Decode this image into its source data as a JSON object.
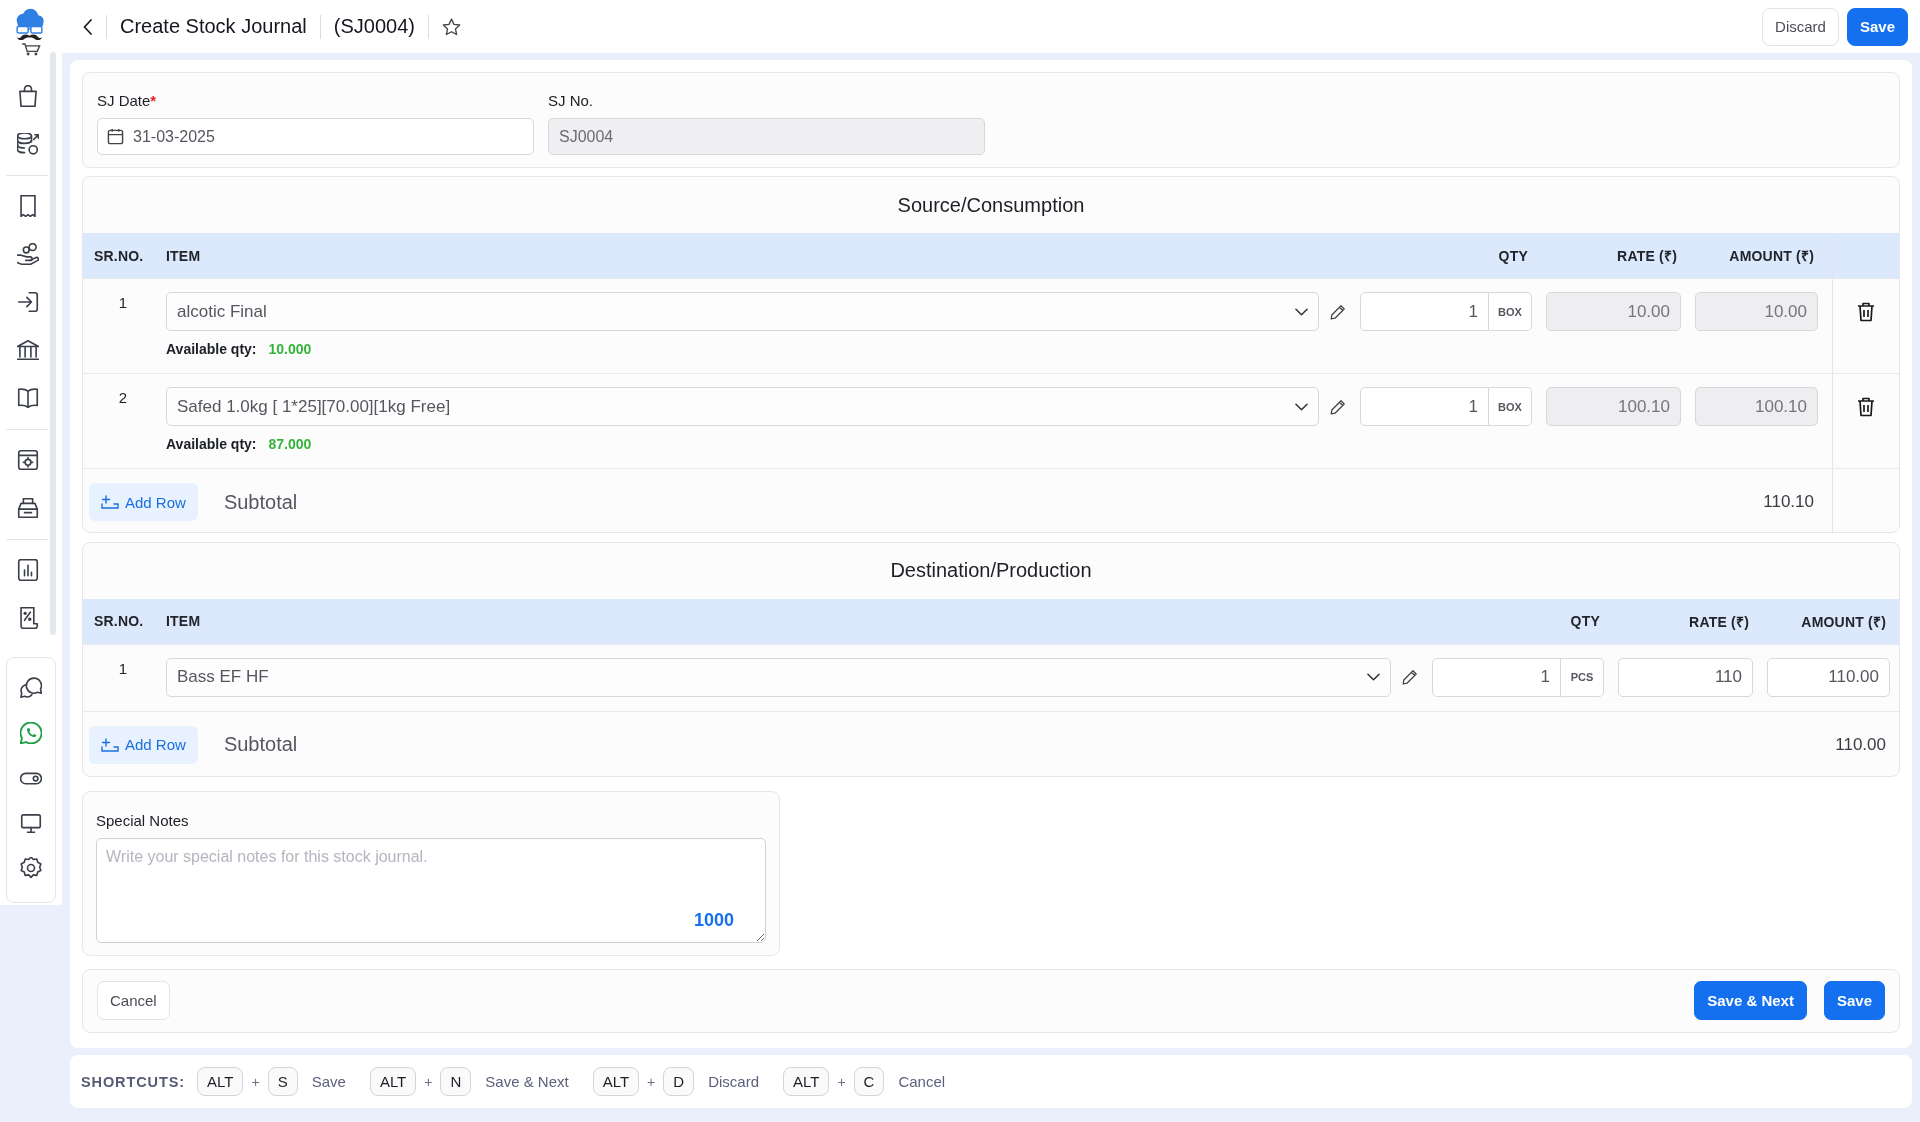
{
  "header": {
    "title": "Create Stock Journal",
    "code": "(SJ0004)",
    "starred": false,
    "buttons": [
      {
        "label": "Discard",
        "kind": "secondary"
      },
      {
        "label": "Save",
        "kind": "primary"
      }
    ]
  },
  "details": {
    "fields": [
      {
        "label": "SJ Date",
        "required_mark": "*",
        "value": "31-03-2025",
        "kind": "date",
        "disabled": false
      },
      {
        "label": "SJ No.",
        "value": "SJ0004",
        "kind": "text",
        "disabled": true
      }
    ]
  },
  "sections": [
    {
      "title": "Source/Consumption",
      "row_delete": true,
      "columns": [
        "SR.NO.",
        "ITEM",
        "QTY",
        "RATE (₹)",
        "AMOUNT (₹)"
      ],
      "rows": [
        {
          "sr": "1",
          "item": "alcotic Final",
          "qty": "1",
          "unit": "BOX",
          "rate": {
            "value": "10.00",
            "disabled": true
          },
          "amount": {
            "value": "10.00",
            "disabled": true
          },
          "available": {
            "label": "Available qty:",
            "value": "10.000"
          }
        },
        {
          "sr": "2",
          "item": "Safed 1.0kg [ 1*25][70.00][1kg Free]",
          "qty": "1",
          "unit": "BOX",
          "rate": {
            "value": "100.10",
            "disabled": true
          },
          "amount": {
            "value": "100.10",
            "disabled": true
          },
          "available": {
            "label": "Available qty:",
            "value": "87.000"
          }
        }
      ],
      "add_row": "Add Row",
      "subtotal_label": "Subtotal",
      "subtotal": "110.10"
    },
    {
      "title": "Destination/Production",
      "row_delete": false,
      "columns": [
        "SR.NO.",
        "ITEM",
        "QTY",
        "RATE (₹)",
        "AMOUNT (₹)"
      ],
      "rows": [
        {
          "sr": "1",
          "item": "Bass EF HF",
          "qty": "1",
          "unit": "PCS",
          "rate": {
            "value": "110",
            "disabled": false
          },
          "amount": {
            "value": "110.00",
            "disabled": false
          }
        }
      ],
      "add_row": "Add Row",
      "subtotal_label": "Subtotal",
      "subtotal": "110.00"
    }
  ],
  "notes": {
    "label": "Special Notes",
    "placeholder": "Write your special notes for this stock journal.",
    "counter": "1000"
  },
  "actions": {
    "left": [
      {
        "label": "Cancel",
        "kind": "secondary"
      }
    ],
    "right": [
      {
        "label": "Save & Next",
        "kind": "primary"
      },
      {
        "label": "Save",
        "kind": "primary"
      }
    ]
  },
  "shortcuts": {
    "label": "SHORTCUTS:",
    "items": [
      {
        "keys": [
          "ALT",
          "S"
        ],
        "plus": "+",
        "action": "Save"
      },
      {
        "keys": [
          "ALT",
          "N"
        ],
        "plus": "+",
        "action": "Save & Next"
      },
      {
        "keys": [
          "ALT",
          "D"
        ],
        "plus": "+",
        "action": "Discard"
      },
      {
        "keys": [
          "ALT",
          "C"
        ],
        "plus": "+",
        "action": "Cancel"
      }
    ]
  }
}
